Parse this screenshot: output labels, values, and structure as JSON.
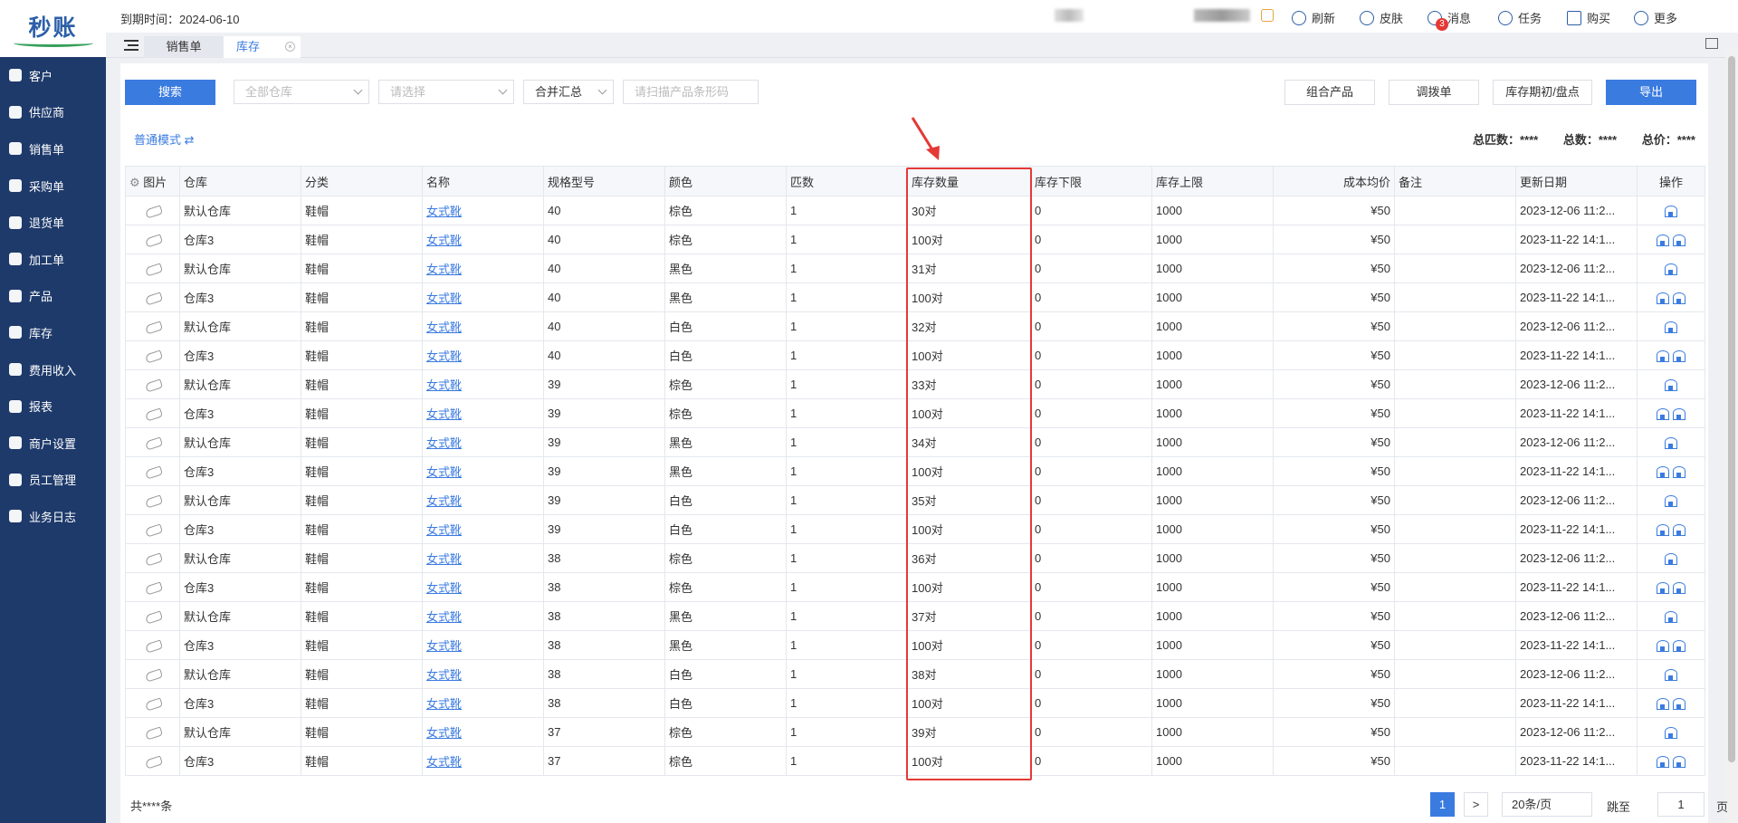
{
  "app": {
    "logo_text": "秒账"
  },
  "sidebar": {
    "items": [
      {
        "label": "客户"
      },
      {
        "label": "供应商"
      },
      {
        "label": "销售单"
      },
      {
        "label": "采购单"
      },
      {
        "label": "退货单"
      },
      {
        "label": "加工单"
      },
      {
        "label": "产品"
      },
      {
        "label": "库存"
      },
      {
        "label": "费用收入"
      },
      {
        "label": "报表"
      },
      {
        "label": "商户设置"
      },
      {
        "label": "员工管理"
      },
      {
        "label": "业务日志"
      }
    ]
  },
  "topbar": {
    "expiry": "到期时间：2024-06-10",
    "refresh": "刷新",
    "skin": "皮肤",
    "message": "消息",
    "message_count": "3",
    "task": "任务",
    "buy": "购买",
    "more": "更多"
  },
  "tabs": {
    "sales": "销售单",
    "inventory": "库存"
  },
  "toolbar": {
    "search": "搜索",
    "warehouse_placeholder": "全部仓库",
    "select_placeholder": "请选择",
    "merge": "合并汇总",
    "scan_placeholder": "请扫描产品条形码",
    "combo": "组合产品",
    "transfer": "调拨单",
    "stocktake": "库存期初/盘点",
    "export": "导出"
  },
  "mode": {
    "label": "普通模式 ⇄"
  },
  "summary": {
    "total_pieces": "总匹数：****",
    "total_count": "总数：****",
    "total_price": "总价：****"
  },
  "table": {
    "headers": [
      "图片",
      "仓库",
      "分类",
      "名称",
      "规格型号",
      "颜色",
      "匹数",
      "库存数量",
      "库存下限",
      "库存上限",
      "成本均价",
      "备注",
      "更新日期",
      "操作"
    ],
    "rows": [
      [
        "默认仓库",
        "鞋帽",
        "女式靴",
        "40",
        "棕色",
        "1",
        "30对",
        "0",
        "1000",
        "¥50",
        "",
        "2023-12-06 11:2..."
      ],
      [
        "仓库3",
        "鞋帽",
        "女式靴",
        "40",
        "棕色",
        "1",
        "100对",
        "0",
        "1000",
        "¥50",
        "",
        "2023-11-22 14:1..."
      ],
      [
        "默认仓库",
        "鞋帽",
        "女式靴",
        "40",
        "黑色",
        "1",
        "31对",
        "0",
        "1000",
        "¥50",
        "",
        "2023-12-06 11:2..."
      ],
      [
        "仓库3",
        "鞋帽",
        "女式靴",
        "40",
        "黑色",
        "1",
        "100对",
        "0",
        "1000",
        "¥50",
        "",
        "2023-11-22 14:1..."
      ],
      [
        "默认仓库",
        "鞋帽",
        "女式靴",
        "40",
        "白色",
        "1",
        "32对",
        "0",
        "1000",
        "¥50",
        "",
        "2023-12-06 11:2..."
      ],
      [
        "仓库3",
        "鞋帽",
        "女式靴",
        "40",
        "白色",
        "1",
        "100对",
        "0",
        "1000",
        "¥50",
        "",
        "2023-11-22 14:1..."
      ],
      [
        "默认仓库",
        "鞋帽",
        "女式靴",
        "39",
        "棕色",
        "1",
        "33对",
        "0",
        "1000",
        "¥50",
        "",
        "2023-12-06 11:2..."
      ],
      [
        "仓库3",
        "鞋帽",
        "女式靴",
        "39",
        "棕色",
        "1",
        "100对",
        "0",
        "1000",
        "¥50",
        "",
        "2023-11-22 14:1..."
      ],
      [
        "默认仓库",
        "鞋帽",
        "女式靴",
        "39",
        "黑色",
        "1",
        "34对",
        "0",
        "1000",
        "¥50",
        "",
        "2023-12-06 11:2..."
      ],
      [
        "仓库3",
        "鞋帽",
        "女式靴",
        "39",
        "黑色",
        "1",
        "100对",
        "0",
        "1000",
        "¥50",
        "",
        "2023-11-22 14:1..."
      ],
      [
        "默认仓库",
        "鞋帽",
        "女式靴",
        "39",
        "白色",
        "1",
        "35对",
        "0",
        "1000",
        "¥50",
        "",
        "2023-12-06 11:2..."
      ],
      [
        "仓库3",
        "鞋帽",
        "女式靴",
        "39",
        "白色",
        "1",
        "100对",
        "0",
        "1000",
        "¥50",
        "",
        "2023-11-22 14:1..."
      ],
      [
        "默认仓库",
        "鞋帽",
        "女式靴",
        "38",
        "棕色",
        "1",
        "36对",
        "0",
        "1000",
        "¥50",
        "",
        "2023-12-06 11:2..."
      ],
      [
        "仓库3",
        "鞋帽",
        "女式靴",
        "38",
        "棕色",
        "1",
        "100对",
        "0",
        "1000",
        "¥50",
        "",
        "2023-11-22 14:1..."
      ],
      [
        "默认仓库",
        "鞋帽",
        "女式靴",
        "38",
        "黑色",
        "1",
        "37对",
        "0",
        "1000",
        "¥50",
        "",
        "2023-12-06 11:2..."
      ],
      [
        "仓库3",
        "鞋帽",
        "女式靴",
        "38",
        "黑色",
        "1",
        "100对",
        "0",
        "1000",
        "¥50",
        "",
        "2023-11-22 14:1..."
      ],
      [
        "默认仓库",
        "鞋帽",
        "女式靴",
        "38",
        "白色",
        "1",
        "38对",
        "0",
        "1000",
        "¥50",
        "",
        "2023-12-06 11:2..."
      ],
      [
        "仓库3",
        "鞋帽",
        "女式靴",
        "38",
        "白色",
        "1",
        "100对",
        "0",
        "1000",
        "¥50",
        "",
        "2023-11-22 14:1..."
      ],
      [
        "默认仓库",
        "鞋帽",
        "女式靴",
        "37",
        "棕色",
        "1",
        "39对",
        "0",
        "1000",
        "¥50",
        "",
        "2023-12-06 11:2..."
      ],
      [
        "仓库3",
        "鞋帽",
        "女式靴",
        "37",
        "棕色",
        "1",
        "100对",
        "0",
        "1000",
        "¥50",
        "",
        "2023-11-22 14:1..."
      ]
    ]
  },
  "pager": {
    "total": "共****条",
    "page": "1",
    "next": ">",
    "page_size": "20条/页",
    "jump_label": "跳至",
    "jump_value": "1",
    "page_word": "页"
  },
  "colors": {
    "primary": "#3a7be0",
    "sidebar": "#1e3a6b",
    "highlight": "#e53935"
  }
}
